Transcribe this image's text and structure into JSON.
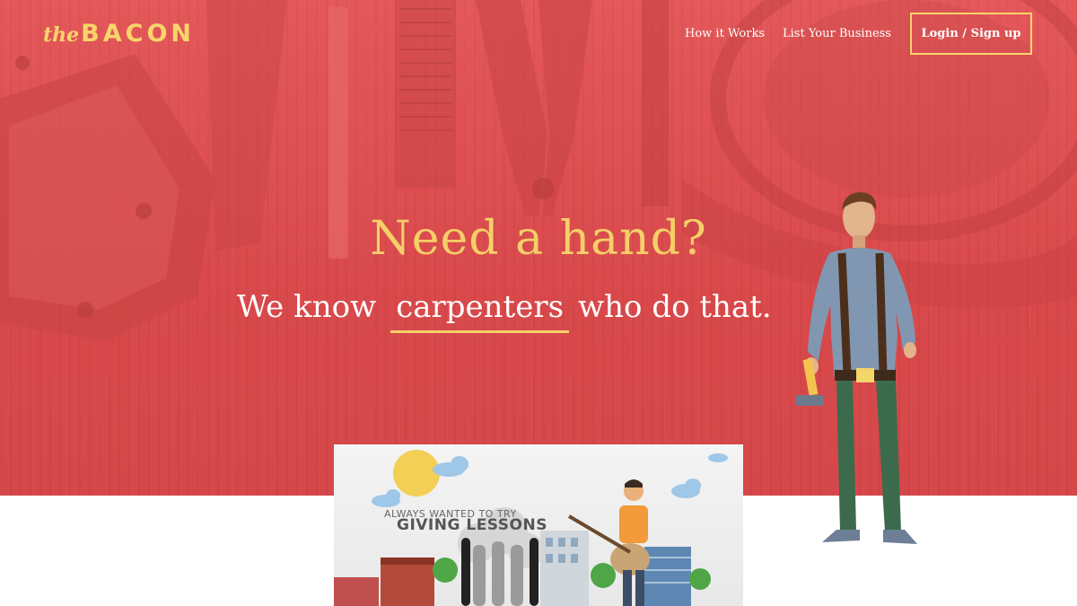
{
  "header": {
    "logo_prefix": "the",
    "logo_main": "BACON",
    "nav": [
      {
        "label": "How it Works"
      },
      {
        "label": "List Your Business"
      }
    ],
    "login_label": "Login / Sign up"
  },
  "hero": {
    "headline": "Need a hand?",
    "sub_before": "We know",
    "sub_rotating": "carpenters",
    "sub_after": "who do that."
  },
  "video": {
    "kicker": "ALWAYS WANTED TO TRY",
    "title": "GIVING LESSONS"
  },
  "colors": {
    "hero_red": "#d9494b",
    "accent_yellow": "#f5cf68",
    "white": "#ffffff"
  },
  "icons": [
    "hammer-icon"
  ]
}
